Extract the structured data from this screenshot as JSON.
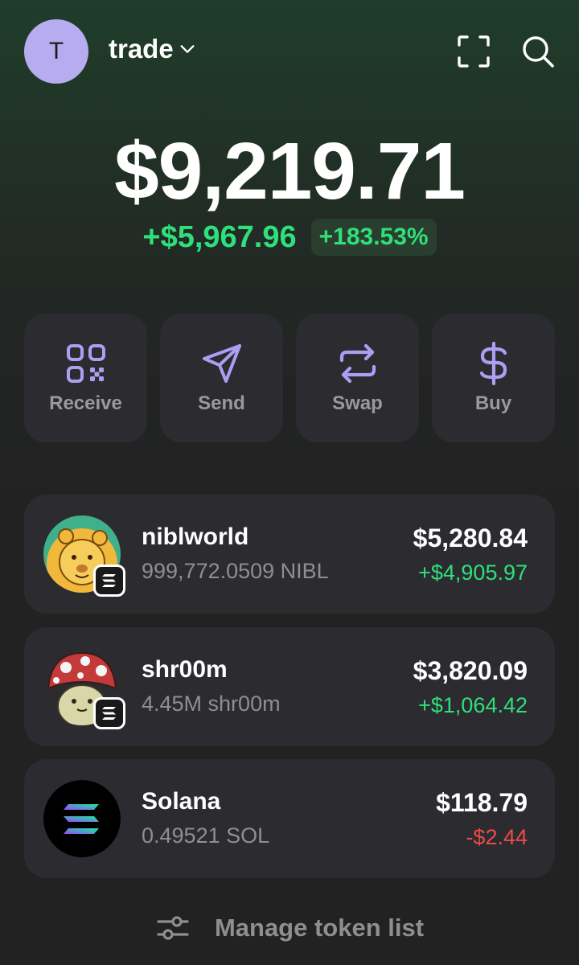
{
  "header": {
    "avatar_letter": "T",
    "account_name": "trade",
    "icons": [
      "chevron-down-icon",
      "scan-icon",
      "search-icon"
    ]
  },
  "portfolio": {
    "balance": "$9,219.71",
    "change_abs": "+$5,967.96",
    "change_pct": "+183.53%"
  },
  "actions": [
    {
      "label": "Receive",
      "icon": "qr-code-icon"
    },
    {
      "label": "Send",
      "icon": "send-icon"
    },
    {
      "label": "Swap",
      "icon": "swap-icon"
    },
    {
      "label": "Buy",
      "icon": "dollar-icon"
    }
  ],
  "tokens": [
    {
      "name": "niblworld",
      "amount": "999,772.0509 NIBL",
      "value": "$5,280.84",
      "change": "+$4,905.97",
      "trend": "positive"
    },
    {
      "name": "shr00m",
      "amount": "4.45M shr00m",
      "value": "$3,820.09",
      "change": "+$1,064.42",
      "trend": "positive"
    },
    {
      "name": "Solana",
      "amount": "0.49521 SOL",
      "value": "$118.79",
      "change": "-$2.44",
      "trend": "negative"
    }
  ],
  "footer": {
    "manage_label": "Manage token list"
  },
  "colors": {
    "accent": "#ab9ff2",
    "positive": "#2fe07a",
    "negative": "#ee4a4a",
    "card": "#2b2b30"
  }
}
